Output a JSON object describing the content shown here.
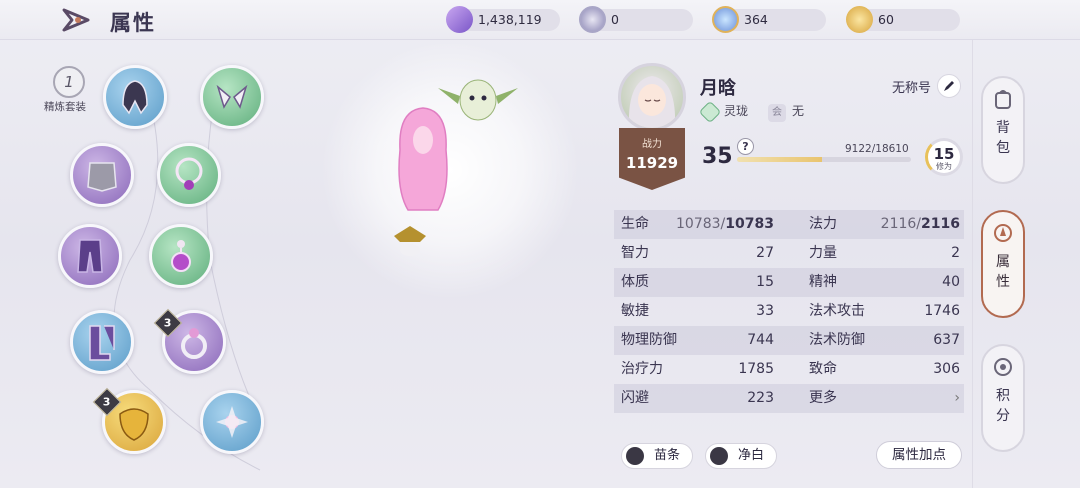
{
  "header": {
    "title": "属性",
    "currencies": [
      {
        "name": "gem-currency",
        "value": "1,438,119"
      },
      {
        "name": "badge-currency",
        "value": "0"
      },
      {
        "name": "crystal-currency",
        "value": "364"
      },
      {
        "name": "coin-currency",
        "value": "60"
      }
    ]
  },
  "equipment": {
    "refine_number": "1",
    "refine_label": "精炼套装",
    "badges": [
      "3",
      "3"
    ]
  },
  "character": {
    "name": "月晗",
    "power_label": "战力",
    "power_value": "11929",
    "faction": "灵珑",
    "guild_icon": "会",
    "guild": "无",
    "title": "无称号",
    "level": "35",
    "exp_text": "9122/18610",
    "exp_fraction": 0.49,
    "cultivation_value": "15",
    "cultivation_label": "修为"
  },
  "stats": {
    "hp_label": "生命",
    "hp_cur": "10783/",
    "hp_max": "10783",
    "mp_label": "法力",
    "mp_cur": "2116/",
    "mp_max": "2116",
    "rows": [
      {
        "l1": "智力",
        "v1": "27",
        "l2": "力量",
        "v2": "2"
      },
      {
        "l1": "体质",
        "v1": "15",
        "l2": "精神",
        "v2": "40"
      },
      {
        "l1": "敏捷",
        "v1": "33",
        "l2": "法术攻击",
        "v2": "1746"
      },
      {
        "l1": "物理防御",
        "v1": "744",
        "l2": "法术防御",
        "v2": "637"
      },
      {
        "l1": "治疗力",
        "v1": "1785",
        "l2": "致命",
        "v2": "306"
      },
      {
        "l1": "闪避",
        "v1": "223",
        "l2": "更多",
        "v2": "›"
      }
    ]
  },
  "bottom": {
    "pill1": "苗条",
    "pill2": "净白",
    "attr_button": "属性加点"
  },
  "side_tabs": [
    "背包",
    "属性",
    "积分"
  ],
  "colors": {
    "accent": "#b26a50",
    "ribbon": "#7a5344",
    "exp": "#e9c46e"
  }
}
